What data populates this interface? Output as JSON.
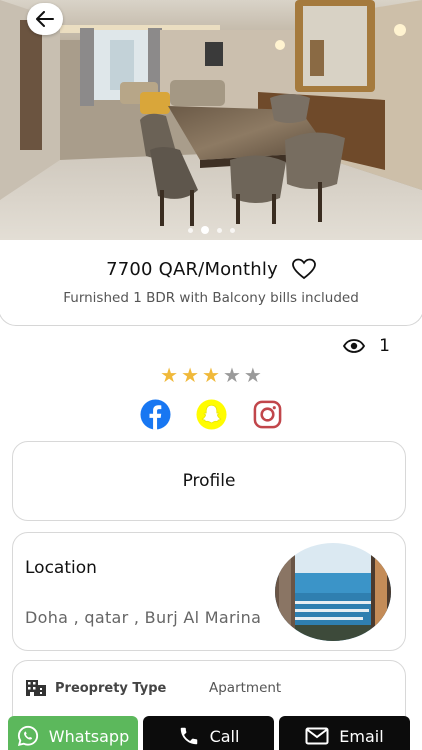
{
  "listing": {
    "price": "7700 QAR/Monthly",
    "subtitle": "Furnished 1 BDR with Balcony bills included",
    "views": "1",
    "rating": 3,
    "rating_max": 5,
    "carousel_page_count": 4,
    "carousel_active_index": 1
  },
  "colors": {
    "star_filled": "#f0b93a",
    "star_empty": "#9a9a9a",
    "whatsapp": "#5cb85c",
    "facebook": "#1877f2",
    "snapchat": "#fffc00",
    "instagram": "#c13584"
  },
  "icons": {
    "back": "arrow-left-icon",
    "favorite": "heart-outline-icon",
    "views": "eye-icon",
    "facebook": "facebook-icon",
    "snapchat": "snapchat-icon",
    "instagram": "instagram-icon",
    "property_type": "building-icon",
    "whatsapp": "whatsapp-icon",
    "call": "phone-icon",
    "email": "mail-icon"
  },
  "profile": {
    "label": "Profile"
  },
  "location": {
    "title": "Location",
    "text": "Doha , qatar , Burj Al Marina"
  },
  "details": {
    "property_type_label": "Preoprety Type",
    "property_type_value": "Apartment"
  },
  "actions": {
    "whatsapp_label": "Whatsapp",
    "call_label": "Call",
    "email_label": "Email"
  }
}
